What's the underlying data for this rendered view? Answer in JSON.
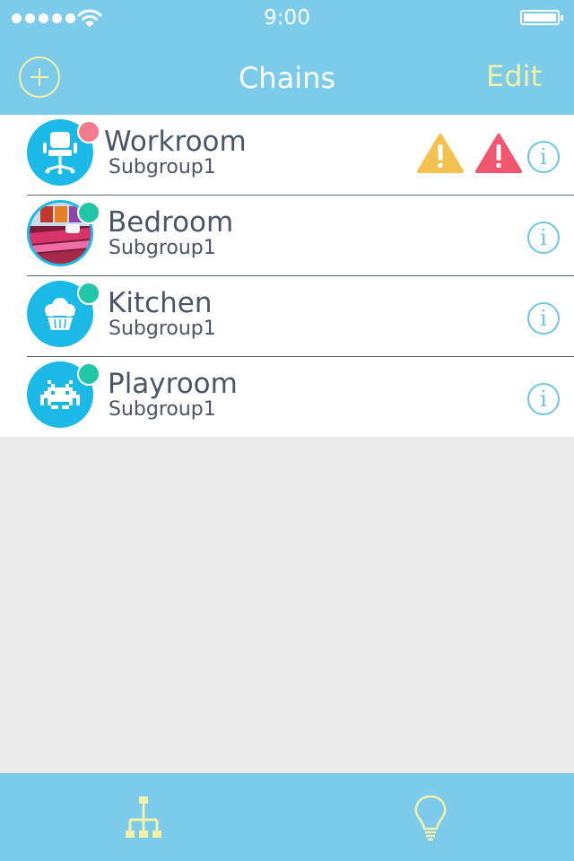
{
  "status_bar": {
    "time": "9:00",
    "signal_bars": 5
  },
  "nav": {
    "title": "Chains",
    "add_icon": "plus-circle-icon",
    "edit_label": "Edit"
  },
  "chains": [
    {
      "name": "Workroom",
      "subgroup": "Subgroup1",
      "icon": "office-chair-icon",
      "status_color": "#f27b8c",
      "warnings": [
        "warning-yellow-icon",
        "warning-red-icon"
      ]
    },
    {
      "name": "Bedroom",
      "subgroup": "Subgroup1",
      "icon": "bedroom-photo",
      "status_color": "#20c6a6",
      "warnings": []
    },
    {
      "name": "Kitchen",
      "subgroup": "Subgroup1",
      "icon": "cupcake-icon",
      "status_color": "#20c6a6",
      "warnings": []
    },
    {
      "name": "Playroom",
      "subgroup": "Subgroup1",
      "icon": "space-invader-icon",
      "status_color": "#20c6a6",
      "warnings": []
    }
  ],
  "tabs": [
    {
      "icon": "hierarchy-tree-icon"
    },
    {
      "icon": "lightbulb-icon"
    }
  ],
  "colors": {
    "header": "#7ccbea",
    "accent_yellow": "#f3f0a8",
    "avatar_blue": "#1ab9e6",
    "text": "#4a5566",
    "warning_yellow": "#f2c14e",
    "warning_red": "#f2566f",
    "background": "#ececec"
  }
}
